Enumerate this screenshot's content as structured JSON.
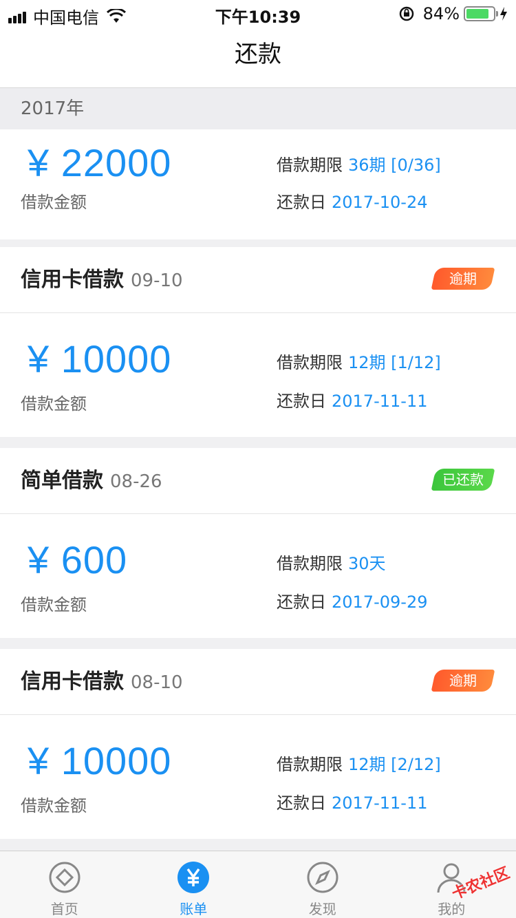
{
  "status_bar": {
    "carrier": "中国电信",
    "time": "下午10:39",
    "battery": "84%",
    "battery_level": 0.84
  },
  "nav": {
    "title": "还款"
  },
  "year_header": "2017年",
  "summary": {
    "amount": "¥ 22000",
    "amount_label": "借款金额",
    "term_label": "借款期限",
    "term_value": "36期 [0/36]",
    "due_label": "还款日",
    "due_value": "2017-10-24"
  },
  "loans": [
    {
      "name": "信用卡借款",
      "date": "09-10",
      "status": "逾期",
      "amount": "¥ 10000",
      "amount_label": "借款金额",
      "term_label": "借款期限",
      "term_value": "12期 [1/12]",
      "due_label": "还款日",
      "due_value": "2017-11-11"
    },
    {
      "name": "简单借款",
      "date": "08-26",
      "status": "已还款",
      "amount": "¥ 600",
      "amount_label": "借款金额",
      "term_label": "借款期限",
      "term_value": "30天",
      "due_label": "还款日",
      "due_value": "2017-09-29"
    },
    {
      "name": "信用卡借款",
      "date": "08-10",
      "status": "逾期",
      "amount": "¥ 10000",
      "amount_label": "借款金额",
      "term_label": "借款期限",
      "term_value": "12期 [2/12]",
      "due_label": "还款日",
      "due_value": "2017-11-11"
    }
  ],
  "tabs": [
    {
      "label": "首页",
      "icon": "home-diamond-icon"
    },
    {
      "label": "账单",
      "icon": "yen-icon"
    },
    {
      "label": "发现",
      "icon": "compass-icon"
    },
    {
      "label": "我的",
      "icon": "user-icon"
    }
  ],
  "watermark": "卡农社区",
  "colors": {
    "accent": "#1a90f2",
    "overdue": "#ff6a30",
    "paid": "#3cc63c"
  }
}
